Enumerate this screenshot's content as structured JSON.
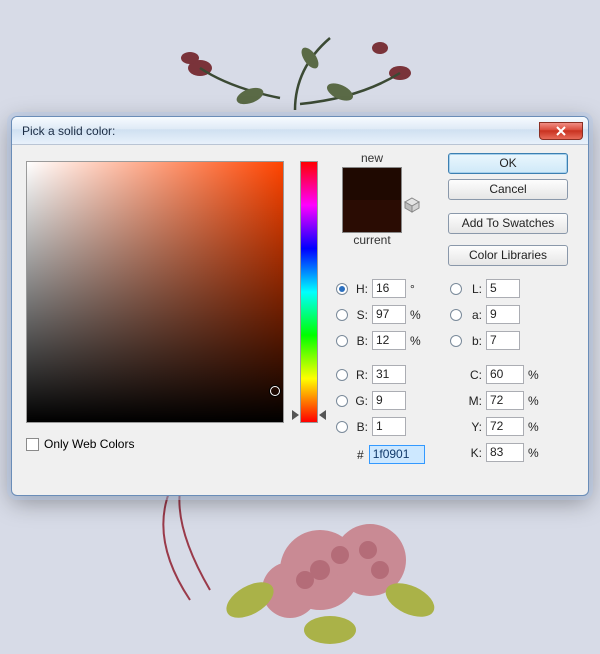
{
  "window": {
    "title": "Pick a solid color:"
  },
  "buttons": {
    "ok": "OK",
    "cancel": "Cancel",
    "add_swatches": "Add To Swatches",
    "color_libraries": "Color Libraries"
  },
  "preview": {
    "new_label": "new",
    "current_label": "current",
    "new_color": "#1f0901",
    "current_color": "#2a0c03"
  },
  "only_web_colors": {
    "label": "Only Web Colors",
    "checked": false
  },
  "hsb": {
    "h_label": "H:",
    "h_value": "16",
    "h_unit": "°",
    "s_label": "S:",
    "s_value": "97",
    "s_unit": "%",
    "b_label": "B:",
    "b_value": "12",
    "b_unit": "%",
    "selected": "H"
  },
  "rgb": {
    "r_label": "R:",
    "r_value": "31",
    "g_label": "G:",
    "g_value": "9",
    "b_label": "B:",
    "b_value": "1"
  },
  "lab": {
    "l_label": "L:",
    "l_value": "5",
    "a_label": "a:",
    "a_value": "9",
    "b_label": "b:",
    "b_value": "7"
  },
  "cmyk": {
    "c_label": "C:",
    "c_value": "60",
    "c_unit": "%",
    "m_label": "M:",
    "m_value": "72",
    "m_unit": "%",
    "y_label": "Y:",
    "y_value": "72",
    "y_unit": "%",
    "k_label": "K:",
    "k_value": "83",
    "k_unit": "%"
  },
  "hex": {
    "label": "#",
    "value": "1f0901"
  },
  "picker": {
    "hue_deg": 16,
    "sv_cursor": {
      "x_pct": 97,
      "y_pct": 88
    },
    "hue_slider_y_pct": 95.5
  },
  "colors": {
    "accent": "#3c7fb1"
  }
}
